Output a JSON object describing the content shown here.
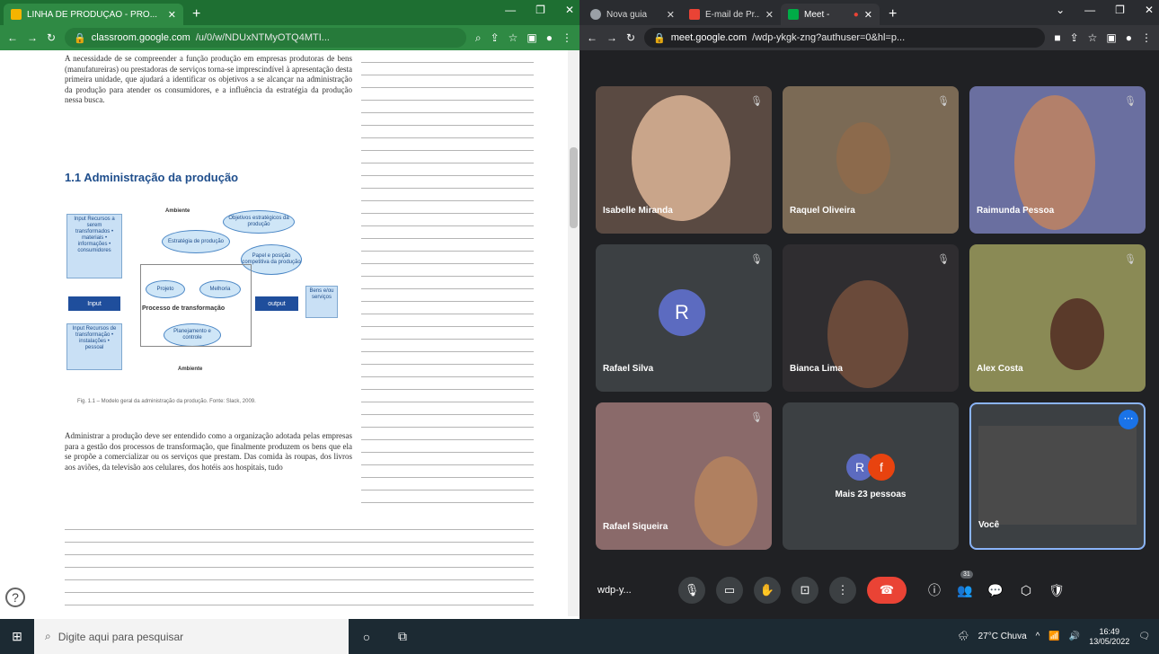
{
  "left_browser": {
    "tab_title": "LINHA DE PRODUÇÃO - PRO...",
    "new_tab": "+",
    "url_domain": "classroom.google.com",
    "url_path": "/u/0/w/NDUxNTMyOTQ4MTI...",
    "window_controls": [
      "—",
      "❐",
      "✕"
    ]
  },
  "document": {
    "intro": "A necessidade de se compreender a função produção em empresas produtoras de bens (manufatureiras) ou prestadoras de serviços torna-se imprescindível à apresentação desta primeira unidade, que ajudará a identificar os objetivos a se alcançar na administração da produção para atender os consumidores, e a influência da estratégia da produção nessa busca.",
    "heading": "1.1 Administração da produção",
    "figure": {
      "ambiente_top": "Ambiente",
      "ambiente_bottom": "Ambiente",
      "input_box1": "Input Recursos a serem transformados • materiais • informações • consumidores",
      "input_box2": "Input Recursos de transformação • instalações • pessoal",
      "input_arrow": "Input",
      "output_arrow": "output",
      "output_box": "Bens e/ou serviços",
      "obj": "Objetivos estratégicos da produção",
      "estrategia": "Estratégia de produção",
      "papel": "Papel e posição competitiva da produção",
      "projeto": "Projeto",
      "melhoria": "Melhoria",
      "processo": "Processo de transformação",
      "planejamento": "Planejamento e controle"
    },
    "caption": "Fig. 1.1 – Modelo geral da administração da produção. Fonte: Slack, 2009.",
    "body": "Administrar a produção deve ser entendido como a organização adotada pelas empresas para a gestão dos processos de transformação, que finalmente produzem os bens que ela se propõe a comercializar ou os serviços que prestam. Das comida às roupas, dos livros aos aviões, da televisão aos celulares, dos hotéis aos hospitais, tudo",
    "help": "?"
  },
  "right_browser": {
    "tabs": [
      "Nova guia",
      "E-mail de Pr...",
      "Meet -"
    ],
    "url_domain": "meet.google.com",
    "url_path": "/wdp-ykgk-zng?authuser=0&hl=p..."
  },
  "meet": {
    "participants": [
      {
        "name": "Isabelle Miranda"
      },
      {
        "name": "Raquel Oliveira"
      },
      {
        "name": "Raimunda Pessoa"
      },
      {
        "name": "Rafael Silva",
        "initial": "R"
      },
      {
        "name": "Bianca Lima"
      },
      {
        "name": "Alex Costa"
      },
      {
        "name": "Rafael Siqueira"
      },
      {
        "more": "Mais 23 pessoas",
        "initials": [
          "R",
          "f"
        ]
      },
      {
        "name": "Você"
      }
    ],
    "meeting_code": "wdp-y...",
    "participant_count": "31"
  },
  "taskbar": {
    "search_placeholder": "Digite aqui para pesquisar",
    "weather": "27°C Chuva",
    "time": "16:49",
    "date": "13/05/2022"
  }
}
